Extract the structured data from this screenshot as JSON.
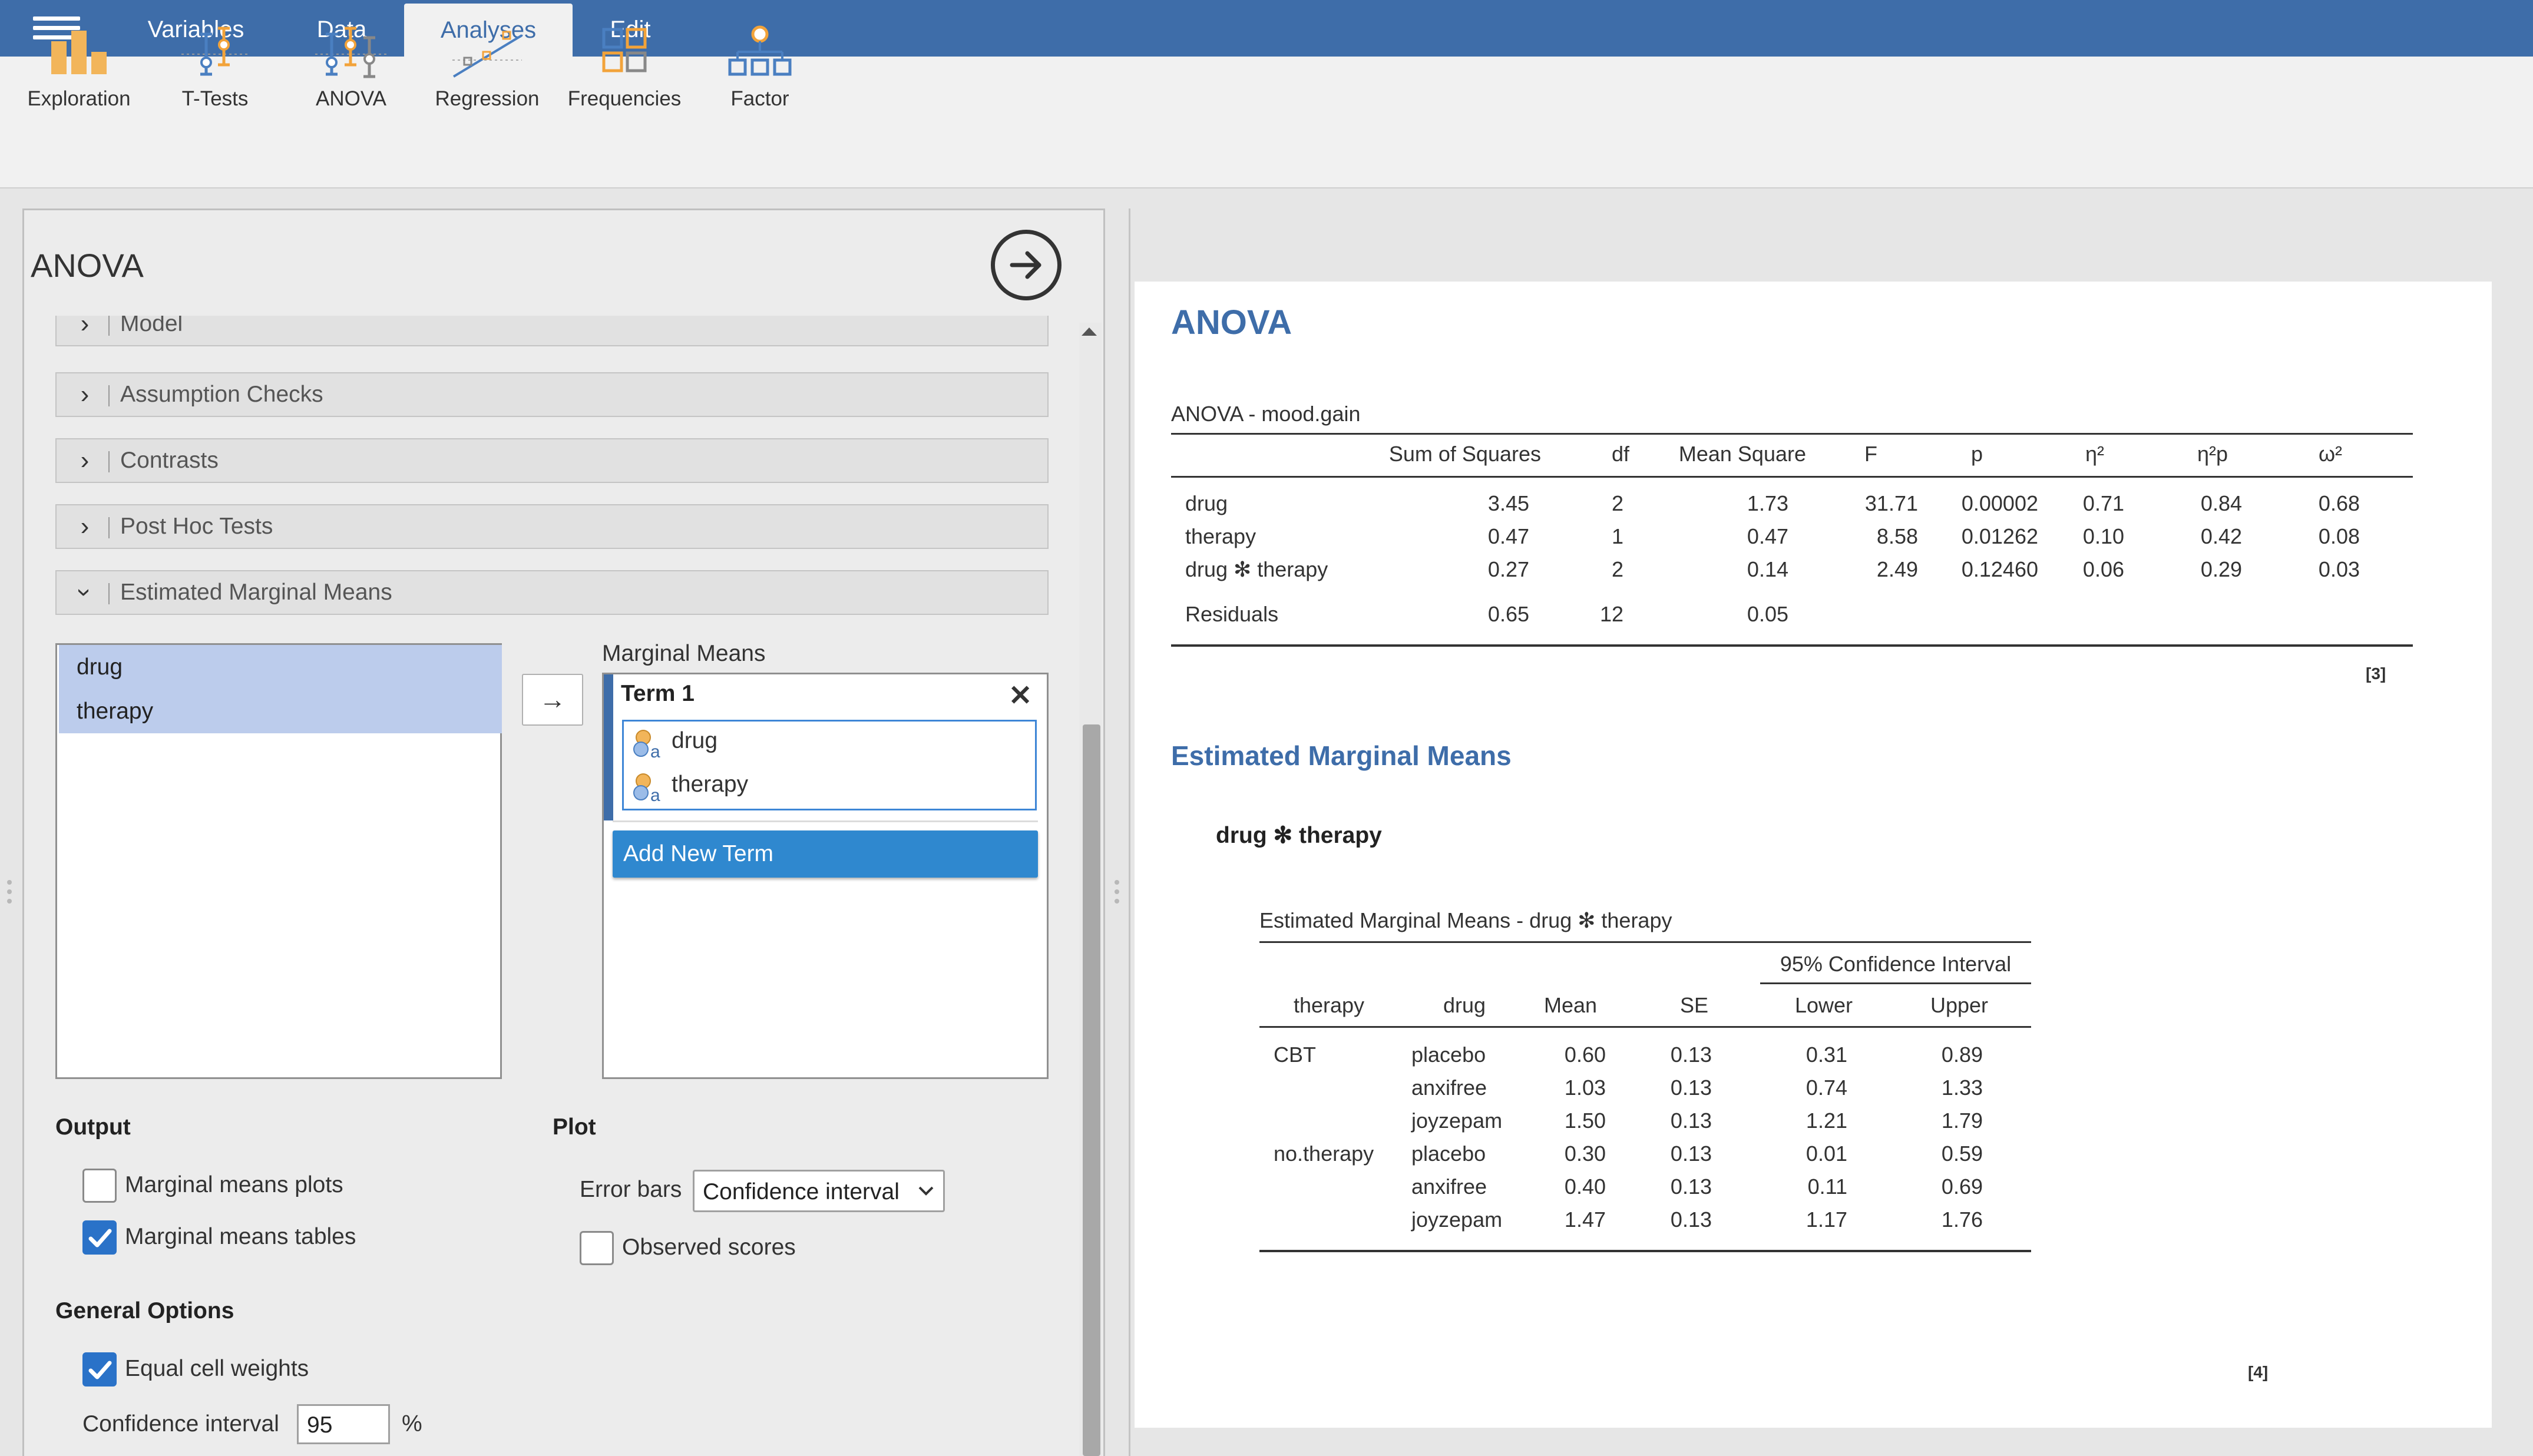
{
  "menu": {
    "tabs": [
      {
        "label": "Variables"
      },
      {
        "label": "Data"
      },
      {
        "label": "Analyses"
      },
      {
        "label": "Edit"
      }
    ]
  },
  "ribbon": {
    "buttons": [
      {
        "label": "Exploration",
        "icon": "exploration-icon"
      },
      {
        "label": "T-Tests",
        "icon": "t-tests-icon"
      },
      {
        "label": "ANOVA",
        "icon": "anova-icon"
      },
      {
        "label": "Regression",
        "icon": "regression-icon"
      },
      {
        "label": "Frequencies",
        "icon": "frequencies-icon"
      },
      {
        "label": "Factor",
        "icon": "factor-icon"
      }
    ]
  },
  "options": {
    "title": "ANOVA",
    "sections": [
      {
        "title": "Model",
        "expanded": false
      },
      {
        "title": "Assumption Checks",
        "expanded": false
      },
      {
        "title": "Contrasts",
        "expanded": false
      },
      {
        "title": "Post Hoc Tests",
        "expanded": false
      },
      {
        "title": "Estimated Marginal Means",
        "expanded": true
      }
    ],
    "available_variables": [
      "drug",
      "therapy"
    ],
    "marginal_means_label": "Marginal Means",
    "term": {
      "title": "Term 1",
      "variables": [
        "drug",
        "therapy"
      ]
    },
    "add_term_label": "Add New Term",
    "output_heading": "Output",
    "plot_heading": "Plot",
    "marginal_means_plots": {
      "label": "Marginal means plots",
      "checked": false
    },
    "marginal_means_tables": {
      "label": "Marginal means tables",
      "checked": true
    },
    "error_bars_label": "Error bars",
    "error_bars_value": "Confidence interval",
    "observed_scores": {
      "label": "Observed scores",
      "checked": false
    },
    "general_heading": "General Options",
    "equal_cell_weights": {
      "label": "Equal cell weights",
      "checked": true
    },
    "ci_label": "Confidence interval",
    "ci_value": "95",
    "ci_unit": "%"
  },
  "results": {
    "heading": "ANOVA",
    "anova_table": {
      "title": "ANOVA - mood.gain",
      "columns": [
        "Sum of Squares",
        "df",
        "Mean Square",
        "F",
        "p",
        "η²",
        "η²p",
        "ω²"
      ],
      "rows": [
        {
          "term": "drug",
          "ss": "3.45",
          "df": "2",
          "ms": "1.73",
          "f": "31.71",
          "p": "0.00002",
          "eta": "0.71",
          "etap": "0.84",
          "omega": "0.68"
        },
        {
          "term": "therapy",
          "ss": "0.47",
          "df": "1",
          "ms": "0.47",
          "f": "8.58",
          "p": "0.01262",
          "eta": "0.10",
          "etap": "0.42",
          "omega": "0.08"
        },
        {
          "term": "drug ✻ therapy",
          "ss": "0.27",
          "df": "2",
          "ms": "0.14",
          "f": "2.49",
          "p": "0.12460",
          "eta": "0.06",
          "etap": "0.29",
          "omega": "0.03"
        },
        {
          "term": "Residuals",
          "ss": "0.65",
          "df": "12",
          "ms": "0.05",
          "f": "",
          "p": "",
          "eta": "",
          "etap": "",
          "omega": ""
        }
      ],
      "ref": "[3]"
    },
    "emm_heading": "Estimated Marginal Means",
    "emm_subheading": "drug ✻ therapy",
    "emm_table": {
      "title": "Estimated Marginal Means - drug ✻ therapy",
      "ci_header": "95% Confidence Interval",
      "columns": [
        "therapy",
        "drug",
        "Mean",
        "SE",
        "Lower",
        "Upper"
      ],
      "rows": [
        {
          "therapy": "CBT",
          "drug": "placebo",
          "mean": "0.60",
          "se": "0.13",
          "lower": "0.31",
          "upper": "0.89"
        },
        {
          "therapy": "",
          "drug": "anxifree",
          "mean": "1.03",
          "se": "0.13",
          "lower": "0.74",
          "upper": "1.33"
        },
        {
          "therapy": "",
          "drug": "joyzepam",
          "mean": "1.50",
          "se": "0.13",
          "lower": "1.21",
          "upper": "1.79"
        },
        {
          "therapy": "no.therapy",
          "drug": "placebo",
          "mean": "0.30",
          "se": "0.13",
          "lower": "0.01",
          "upper": "0.59"
        },
        {
          "therapy": "",
          "drug": "anxifree",
          "mean": "0.40",
          "se": "0.13",
          "lower": "0.11",
          "upper": "0.69"
        },
        {
          "therapy": "",
          "drug": "joyzepam",
          "mean": "1.47",
          "se": "0.13",
          "lower": "1.17",
          "upper": "1.76"
        }
      ],
      "ref": "[4]"
    }
  }
}
